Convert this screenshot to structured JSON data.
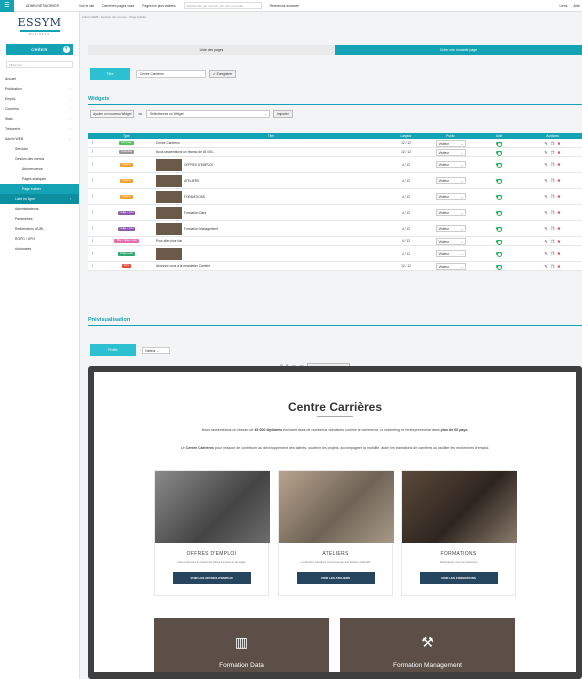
{
  "topbar": {
    "user": "ADMIN NETWORKER",
    "links": [
      "Voir le site",
      "Dernières pages vues",
      "Pages les plus visitées"
    ],
    "search_placeholder": "Rechercher par mot-clé, par nom ou email",
    "advanced": "Recherche avancée",
    "right": [
      "Liens",
      "Aide"
    ]
  },
  "sidebar": {
    "logo": "ESSYM",
    "logo_sub": "BUSINESS",
    "create": "CRÉER",
    "filter_placeholder": "Filtrer par ...",
    "items": [
      {
        "label": "Accueil",
        "icon": "home-icon"
      },
      {
        "label": "Publication",
        "icon": "edit-icon",
        "chev": true
      },
      {
        "label": "Emploi",
        "icon": "briefcase-icon",
        "chev": true
      },
      {
        "label": "Courriers",
        "icon": "mail-icon",
        "chev": true
      },
      {
        "label": "Stats",
        "icon": "chart-icon",
        "chev": true
      },
      {
        "label": "Trésorerie",
        "icon": "money-icon",
        "chev": true
      },
      {
        "label": "Admin WEB",
        "icon": "gear-icon",
        "chev": true
      }
    ],
    "sub_items": [
      "Services",
      "Gestion des menus",
      "Arborescence",
      "Pages statiques",
      "Page builder",
      "Liste en ligne",
      "Administrateurs",
      "Paramètres",
      "Redirections d'URL",
      "RGPD / DPO",
      "Automates"
    ]
  },
  "breadcrumb": "Admin WEB  ›  Gestion des menus  ›  Page builder",
  "tabs": [
    "Liste des pages",
    "Créer une nouvelle page"
  ],
  "title_row": {
    "label": "Titre",
    "value": "Centre Carrières",
    "save": "Enregistrer"
  },
  "widgets": {
    "heading": "Widgets",
    "add": "Ajouter un nouveau Widget",
    "or": "ou",
    "select": "Sélectionnez un Widget",
    "import": "Importer"
  },
  "table": {
    "headers": [
      "Type",
      "Titre",
      "Largeur",
      "Public",
      "Actif",
      "Actions"
    ],
    "rows": [
      {
        "type": "Intro page",
        "color": "#54c05a",
        "title": "Centre Carrières",
        "width": "12 / 12",
        "public": "Visiteur",
        "thumb": false
      },
      {
        "type": "Texte libre",
        "color": "#999999",
        "title": "Nous rassemblons un réseau de 45 000...",
        "width": "12 / 12",
        "public": "Visiteur",
        "thumb": false
      },
      {
        "type": "Vignette",
        "color": "#f0a030",
        "title": "OFFRES D'EMPLOI",
        "width": "4 / 12",
        "public": "Visiteur",
        "thumb": true
      },
      {
        "type": "Vignette",
        "color": "#f0a030",
        "title": "ATELIERS",
        "width": "4 / 12",
        "public": "Visiteur",
        "thumb": true
      },
      {
        "type": "Vignette",
        "color": "#f0a030",
        "title": "FORMATIONS",
        "width": "4 / 12",
        "public": "Visiteur",
        "thumb": true
      },
      {
        "type": "Image + Lien",
        "color": "#8e5aa8",
        "title": "Formation Data",
        "width": "4 / 12",
        "public": "Visiteur",
        "thumb": true
      },
      {
        "type": "Image + Lien",
        "color": "#8e5aa8",
        "title": "Formation Management",
        "width": "4 / 12",
        "public": "Visiteur",
        "thumb": true
      },
      {
        "type": "Titre + Texte + Lien",
        "color": "#e36fb0",
        "title": "Pour aller plus loin",
        "width": "4 / 12",
        "public": "Visiteur",
        "thumb": false
      },
      {
        "type": "Image seule",
        "color": "#2ea86e",
        "title": "",
        "width": "4 / 12",
        "public": "Visiteur",
        "thumb": true
      },
      {
        "type": "Form",
        "color": "#e64a3c",
        "title": "Abonnez-vous à la newsletter Carrière",
        "width": "12 / 12",
        "public": "Visiteur",
        "thumb": false
      }
    ]
  },
  "preview": {
    "heading": "Prévisualisation",
    "profile_label": "Profils",
    "profile": "Visiteur",
    "apercu": "Aperçu dans le navigateur",
    "page_title": "Centre Carrières",
    "para1_a": "Nous rassemblons un réseau de ",
    "para1_b": "45 000 diplômés",
    "para1_c": " évoluant dans de nombreux domaines comme le commerce, le marketing et l'entrepreneuriat dans ",
    "para1_d": "plus de 60 pays.",
    "para2_a": "Le ",
    "para2_b": "Centre Carrières",
    "para2_c": " pour mission de contribuer au développement des talents, soutenir les projets, accompagner la mobilité, aider les transitions de carrières ou faciliter les recherches d'emploi.",
    "cards": [
      {
        "title": "OFFRES D'EMPLOI",
        "desc": "Vous retrouvez ici toutes les offres d'emploi et de stage",
        "btn": "VOIR LES OFFRES D'EMPLOI"
      },
      {
        "title": "ATELIERS",
        "desc": "Le Service Carrières vous propose des ateliers collectifs",
        "btn": "VOIR LES ATELIERS"
      },
      {
        "title": "FORMATIONS",
        "desc": "Développez vos compétences",
        "btn": "VOIR LES FORMATIONS"
      }
    ],
    "banners": [
      "Formation Data",
      "Formation Management"
    ]
  }
}
